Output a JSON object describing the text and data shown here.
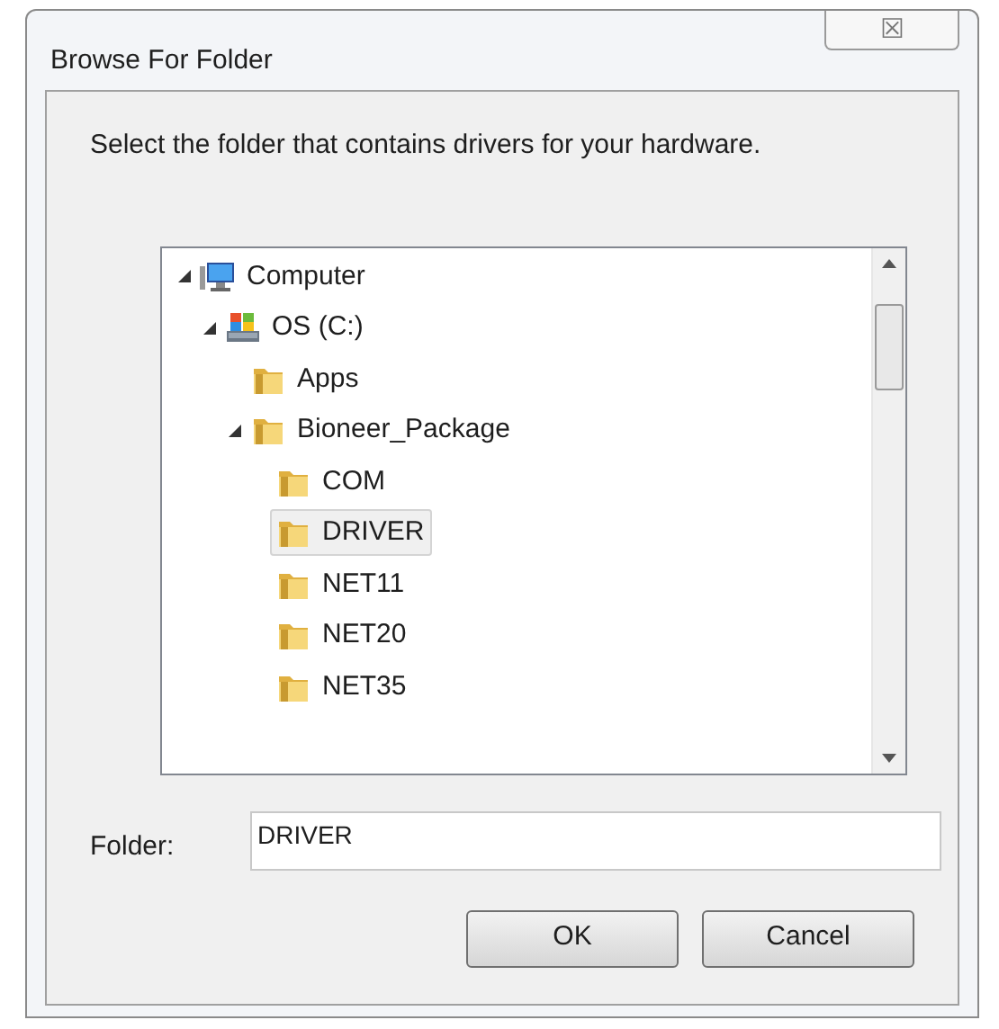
{
  "window": {
    "title": "Browse For Folder",
    "close_label": "☒"
  },
  "instruction": "Select the folder that contains drivers for your hardware.",
  "tree": [
    {
      "label": "Computer",
      "kind": "computer",
      "expanded": true,
      "selected": false,
      "children": [
        {
          "label": "OS (C:)",
          "kind": "drive",
          "expanded": true,
          "selected": false,
          "children": [
            {
              "label": "Apps",
              "kind": "folder",
              "expanded": false,
              "selected": false
            },
            {
              "label": "Bioneer_Package",
              "kind": "folder",
              "expanded": true,
              "selected": false,
              "children": [
                {
                  "label": "COM",
                  "kind": "folder",
                  "expanded": false,
                  "selected": false
                },
                {
                  "label": "DRIVER",
                  "kind": "folder",
                  "expanded": false,
                  "selected": true
                },
                {
                  "label": "NET11",
                  "kind": "folder",
                  "expanded": false,
                  "selected": false
                },
                {
                  "label": "NET20",
                  "kind": "folder",
                  "expanded": false,
                  "selected": false
                },
                {
                  "label": "NET35",
                  "kind": "folder",
                  "expanded": false,
                  "selected": false
                }
              ]
            }
          ]
        }
      ]
    }
  ],
  "folder_field": {
    "label": "Folder:",
    "value": "DRIVER"
  },
  "buttons": [
    "OK",
    "Cancel"
  ]
}
